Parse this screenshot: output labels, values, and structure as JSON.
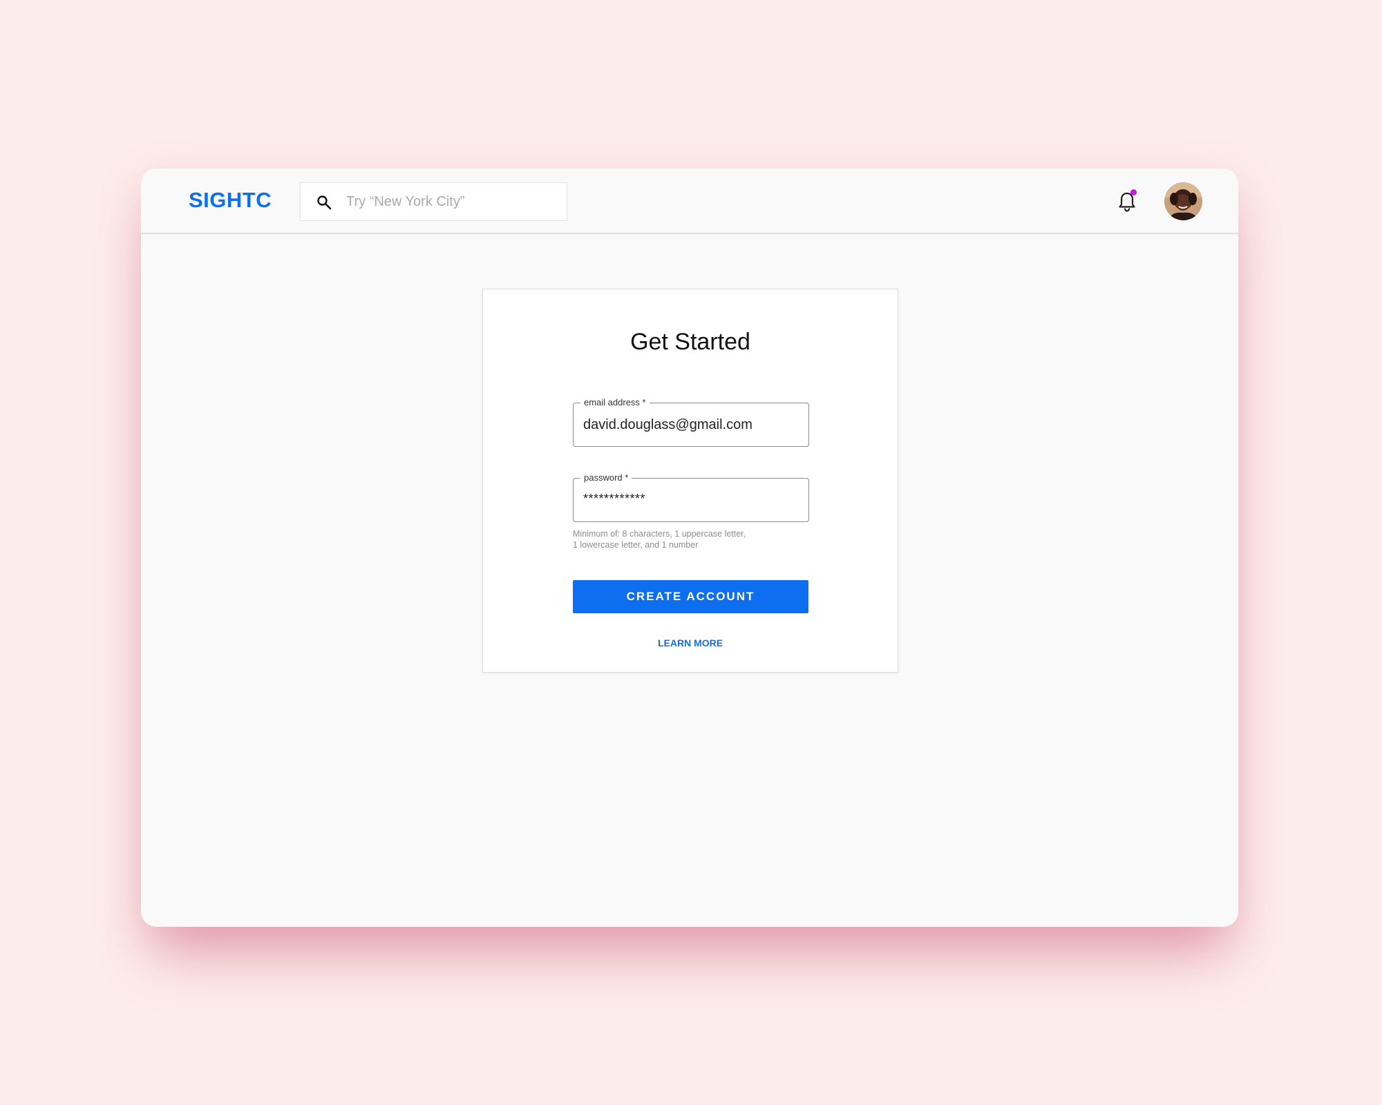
{
  "app": {
    "logo": "SIGHTC",
    "brand_color": "#0d6ff0",
    "background_color": "#fdecec"
  },
  "header": {
    "search": {
      "placeholder": "Try “New York City”",
      "value": "",
      "icon": "search-icon"
    },
    "notifications": {
      "icon": "bell-icon",
      "has_unread": true,
      "dot_color": "#c41dd6"
    },
    "avatar": {
      "icon": "user-avatar"
    }
  },
  "form": {
    "title": "Get Started",
    "email": {
      "label": "email address *",
      "value": "david.douglass@gmail.com"
    },
    "password": {
      "label": "password *",
      "value": "************",
      "hint_line1": "Minimum of: 8 characters, 1 uppercase letter,",
      "hint_line2": "1 lowercase letter, and 1 number"
    },
    "submit_label": "CREATE ACCOUNT",
    "secondary_link": "LEARN MORE"
  }
}
